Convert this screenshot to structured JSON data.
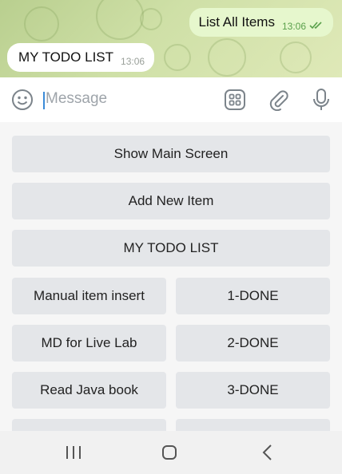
{
  "messages": {
    "outgoing": {
      "text": "List All Items",
      "time": "13:06"
    },
    "incoming": {
      "text": "MY TODO LIST",
      "time": "13:06"
    }
  },
  "input": {
    "placeholder": "Message"
  },
  "icons": {
    "emoji": "emoji-icon",
    "bot_keyboard": "bot-keyboard-icon",
    "attach": "paperclip-icon",
    "mic": "microphone-icon",
    "read": "double-check-icon",
    "nav_recents": "recents-icon",
    "nav_home": "home-icon",
    "nav_back": "back-icon"
  },
  "keyboard": {
    "rows": [
      [
        "Show Main Screen"
      ],
      [
        "Add New Item"
      ],
      [
        "MY TODO LIST"
      ],
      [
        "Manual item insert",
        "1-DONE"
      ],
      [
        "MD for Live Lab",
        "2-DONE"
      ],
      [
        "Read Java book",
        "3-DONE"
      ]
    ]
  },
  "colors": {
    "outgoing_bubble": "#e6f7cd",
    "incoming_bubble": "#ffffff",
    "key_button": "#e4e6e9",
    "read_tick": "#5aa04b",
    "cursor": "#3b8bd8"
  }
}
